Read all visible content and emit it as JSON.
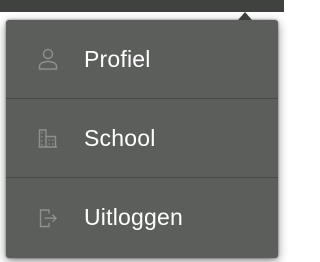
{
  "colors": {
    "menu_background": "#5b5e5b",
    "divider": "#474a47",
    "text": "#ffffff",
    "icon": "#8e918e"
  },
  "menu": {
    "items": [
      {
        "label": "Profiel",
        "icon": "person-icon"
      },
      {
        "label": "School",
        "icon": "building-icon"
      },
      {
        "label": "Uitloggen",
        "icon": "logout-icon"
      }
    ]
  }
}
